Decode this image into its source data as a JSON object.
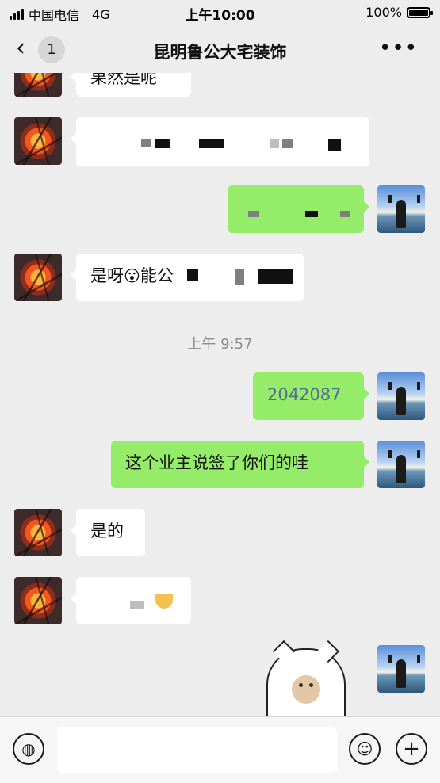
{
  "status_bar": {
    "carrier": "中国电信",
    "network": "4G",
    "time": "上午10:00",
    "battery": "100%"
  },
  "nav": {
    "back_icon": "chevron-left-icon",
    "unread_count": "1",
    "title": "昆明鲁公大宅装饰",
    "more_label": "•••"
  },
  "messages": [
    {
      "side": "left",
      "text": "果然是呢"
    },
    {
      "side": "left",
      "text": ""
    },
    {
      "side": "right",
      "text": ""
    },
    {
      "side": "left",
      "text": "是呀",
      "emoji": "😮",
      "text_suffix": "能公"
    },
    {
      "side": "right",
      "text": "2042087"
    },
    {
      "side": "right",
      "text": "这个业主说签了你们的哇"
    },
    {
      "side": "left",
      "text": "是的"
    },
    {
      "side": "left",
      "text": ""
    }
  ],
  "timestamp": "上午 9:57",
  "input": {
    "voice_icon": "voice-icon",
    "emoji_icon": "smile-icon",
    "plus_icon": "plus-icon",
    "placeholder": ""
  },
  "colors": {
    "background": "#ededed",
    "outgoing_bubble": "#95ec69",
    "incoming_bubble": "#ffffff",
    "number_link": "#576b95"
  }
}
